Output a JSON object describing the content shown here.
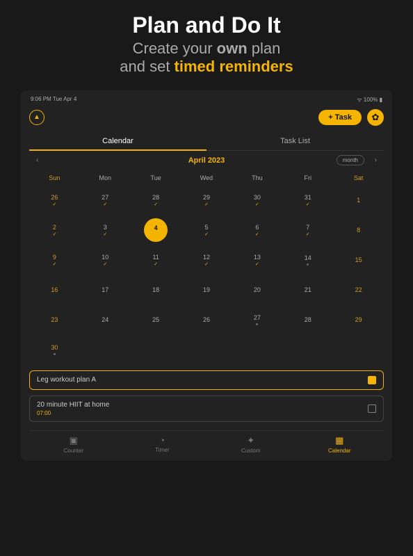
{
  "promo": {
    "title": "Plan and Do It",
    "line1a": "Create your ",
    "line1b": "own",
    "line1c": " plan",
    "line2a": "and set ",
    "line2b": "timed reminders"
  },
  "status": {
    "left": "9:06 PM   Tue Apr 4",
    "right": "100%"
  },
  "top": {
    "task_btn": "+  Task"
  },
  "tabs": {
    "calendar": "Calendar",
    "tasklist": "Task List"
  },
  "month": {
    "label": "April 2023",
    "mode": "month"
  },
  "dow": [
    "Sun",
    "Mon",
    "Tue",
    "Wed",
    "Thu",
    "Fri",
    "Sat"
  ],
  "weeks": [
    [
      {
        "d": "26",
        "we": true,
        "t": true
      },
      {
        "d": "27",
        "t": true
      },
      {
        "d": "28",
        "t": true
      },
      {
        "d": "29",
        "t": true
      },
      {
        "d": "30",
        "t": true
      },
      {
        "d": "31",
        "t": true
      },
      {
        "d": "1",
        "we": true
      }
    ],
    [
      {
        "d": "2",
        "we": true,
        "t": true
      },
      {
        "d": "3",
        "t": true
      },
      {
        "d": "4",
        "sel": true,
        "dot": true
      },
      {
        "d": "5",
        "t": true
      },
      {
        "d": "6",
        "t": true
      },
      {
        "d": "7",
        "t": true
      },
      {
        "d": "8",
        "we": true
      }
    ],
    [
      {
        "d": "9",
        "we": true,
        "t": true
      },
      {
        "d": "10",
        "t": true
      },
      {
        "d": "11",
        "t": true
      },
      {
        "d": "12",
        "t": true
      },
      {
        "d": "13",
        "t": true
      },
      {
        "d": "14",
        "dot": true
      },
      {
        "d": "15",
        "we": true
      }
    ],
    [
      {
        "d": "16",
        "we": true
      },
      {
        "d": "17"
      },
      {
        "d": "18"
      },
      {
        "d": "19"
      },
      {
        "d": "20"
      },
      {
        "d": "21"
      },
      {
        "d": "22",
        "we": true
      }
    ],
    [
      {
        "d": "23",
        "we": true
      },
      {
        "d": "24"
      },
      {
        "d": "25"
      },
      {
        "d": "26"
      },
      {
        "d": "27",
        "dot": true
      },
      {
        "d": "28"
      },
      {
        "d": "29",
        "we": true
      }
    ],
    [
      {
        "d": "30",
        "we": true,
        "dot": true
      },
      {
        "d": ""
      },
      {
        "d": ""
      },
      {
        "d": ""
      },
      {
        "d": ""
      },
      {
        "d": ""
      },
      {
        "d": ""
      }
    ]
  ],
  "tasks": [
    {
      "title": "Leg workout plan A",
      "active": true,
      "done": false
    },
    {
      "title": "20 minute HIIT at home",
      "time": "07:00",
      "active": false,
      "done": true
    }
  ],
  "nav": {
    "counter": "Counter",
    "timer": "Timer",
    "custom": "Custom",
    "calendar": "Calendar"
  }
}
